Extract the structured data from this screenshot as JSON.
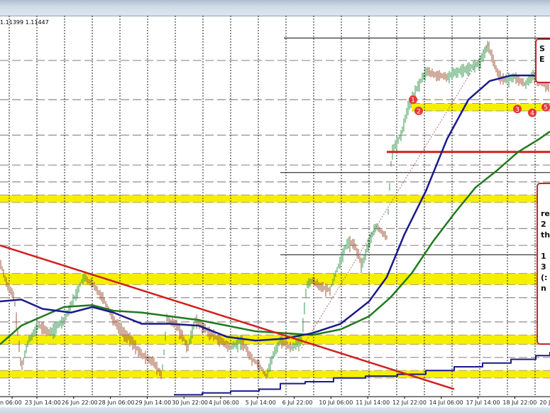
{
  "header": {
    "quote_text": "1.11399 1.11447"
  },
  "colors": {
    "ma_blue": "#1a1a8c",
    "ma_green": "#1f7a1f",
    "trend_red": "#d0211f",
    "band_yellow": "#f5f000",
    "up_candle": "#3a9a50",
    "down_candle": "#a05a3c",
    "marker_red": "#e53935"
  },
  "annotations": {
    "box1": [
      "S",
      "E"
    ],
    "box2": [
      "re",
      "2",
      "th",
      "",
      "1",
      "3",
      "(:",
      "n"
    ]
  },
  "markers": [
    {
      "label": "1",
      "x": 232.8,
      "price": 1.1255
    },
    {
      "label": "2",
      "x": 236,
      "price": 1.1249
    },
    {
      "label": "3",
      "x": 291.6,
      "price": 1.125
    },
    {
      "label": "4",
      "x": 300,
      "price": 1.1248
    },
    {
      "label": "5",
      "x": 307.6,
      "price": 1.1251
    }
  ],
  "chart_data": {
    "type": "line",
    "title": "",
    "xlabel": "",
    "ylabel": "",
    "xlim": [
      0,
      310
    ],
    "ylim": [
      1.1096,
      1.13
    ],
    "grid": true,
    "x_tick_labels": [
      "n 06:00",
      "23 Jun 14:00",
      "26 Jun 22:00",
      "28 Jun 06:00",
      "29 Jun 14:00",
      "30 Jun 22:00",
      "4 Jul 06:00",
      "5 Jul 14:00",
      "6 Jul 22:00",
      "10 Jul 06:00",
      "11 Jul 14:00",
      "12 Jul 22:00",
      "14 Jul 06:00",
      "17 Jul 14:00",
      "18 Jul 22:00",
      "20 J"
    ],
    "series": [
      {
        "name": "price",
        "x": [
          0,
          4,
          8,
          12,
          16,
          22,
          28,
          36,
          42,
          47.2,
          52,
          58,
          64,
          70,
          74,
          80,
          86,
          91.2,
          94,
          100,
          106,
          110,
          116,
          124,
          130,
          136,
          142,
          146,
          150,
          154,
          158,
          164,
          170,
          172.8,
          176,
          182,
          186,
          190,
          196,
          200,
          204,
          208,
          212,
          218,
          219.2,
          220.8,
          226,
          230,
          234,
          240,
          246,
          252,
          258,
          264,
          270,
          275.2,
          280,
          284,
          290,
          296,
          300,
          304,
          310
        ],
        "values": [
          1.1168,
          1.1156,
          1.1149,
          1.1111,
          1.1126,
          1.1134,
          1.113,
          1.1137,
          1.1149,
          1.116,
          1.1156,
          1.1149,
          1.1137,
          1.113,
          1.1126,
          1.1118,
          1.1115,
          1.1107,
          1.1137,
          1.1134,
          1.1122,
          1.1137,
          1.1132,
          1.1126,
          1.1122,
          1.1126,
          1.1116,
          1.1113,
          1.1107,
          1.1118,
          1.1126,
          1.1122,
          1.1126,
          1.1156,
          1.1158,
          1.1154,
          1.1153,
          1.1164,
          1.1179,
          1.1177,
          1.1166,
          1.1179,
          1.1187,
          1.1181,
          1.1202,
          1.1227,
          1.1236,
          1.1251,
          1.1259,
          1.127,
          1.1268,
          1.1267,
          1.127,
          1.1272,
          1.1274,
          1.1284,
          1.127,
          1.1265,
          1.1267,
          1.1263,
          1.1268,
          1.1265,
          1.1261
        ]
      },
      {
        "name": "ma-blue",
        "x": [
          0,
          12,
          24,
          40,
          52,
          64,
          80,
          96,
          112,
          128,
          144,
          160,
          176,
          192,
          208,
          218,
          228,
          240,
          252,
          264,
          276,
          288,
          300,
          310
        ],
        "values": [
          1.1147,
          1.1148,
          1.1143,
          1.1141,
          1.1144,
          1.1141,
          1.1135,
          1.1135,
          1.1134,
          1.1128,
          1.1126,
          1.1127,
          1.113,
          1.1135,
          1.1147,
          1.116,
          1.1183,
          1.1206,
          1.1234,
          1.1255,
          1.1265,
          1.1268,
          1.1268,
          1.1267
        ]
      },
      {
        "name": "ma-green",
        "x": [
          0,
          12,
          24,
          36,
          52,
          64,
          80,
          96,
          112,
          128,
          144,
          160,
          176,
          192,
          208,
          220,
          232,
          244,
          256,
          268,
          280,
          292,
          304,
          310
        ],
        "values": [
          1.1124,
          1.1134,
          1.1139,
          1.1144,
          1.1145,
          1.1142,
          1.1141,
          1.1139,
          1.1137,
          1.1134,
          1.1131,
          1.113,
          1.1129,
          1.1132,
          1.1139,
          1.1149,
          1.1162,
          1.1179,
          1.1194,
          1.1208,
          1.1217,
          1.1227,
          1.1234,
          1.1238
        ]
      },
      {
        "name": "step-line",
        "x": [
          98,
          114,
          130,
          146,
          158,
          172,
          188,
          206,
          224,
          240,
          256,
          272,
          288,
          302,
          310
        ],
        "values": [
          1.1097,
          1.1098,
          1.1099,
          1.11,
          1.1103,
          1.1104,
          1.1106,
          1.1107,
          1.1108,
          1.111,
          1.1112,
          1.1114,
          1.1116,
          1.1118,
          1.112
        ]
      }
    ],
    "trend_line": {
      "x": [
        0,
        256
      ],
      "values": [
        1.1177,
        1.11
      ]
    },
    "channel_line": {
      "x": [
        170,
        276
      ],
      "values": [
        1.1122,
        1.1286
      ]
    },
    "yellow_bands": [
      {
        "from": 1.1249,
        "to": 1.1253,
        "x_start": 232
      },
      {
        "from": 1.12,
        "to": 1.1204,
        "x_start": 0
      },
      {
        "from": 1.1156,
        "to": 1.1162,
        "x_start": 0
      },
      {
        "from": 1.1124,
        "to": 1.1129,
        "x_start": 0
      },
      {
        "from": 1.1106,
        "to": 1.111,
        "x_start": 0
      }
    ],
    "red_level": {
      "price": 1.1227,
      "x_start": 218
    },
    "black_levels": [
      {
        "price": 1.1288,
        "x_start": 160
      },
      {
        "price": 1.1216,
        "x_start": 158
      },
      {
        "price": 1.1172,
        "x_start": 158
      }
    ],
    "dashed_levels": [
      1.1276,
      1.1255,
      1.1236,
      1.122,
      1.1211,
      1.1186,
      1.1177,
      1.1149,
      1.1136,
      1.1117
    ]
  }
}
